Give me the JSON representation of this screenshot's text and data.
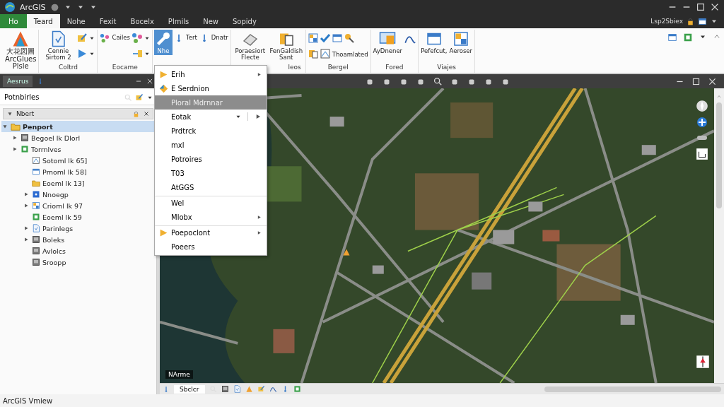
{
  "window": {
    "title": "ArcGIS",
    "user": "Lsp2Sbiex"
  },
  "tabs": [
    {
      "label": "Ho",
      "kind": "file",
      "selected": false
    },
    {
      "label": "Teard",
      "kind": "tab",
      "selected": true
    },
    {
      "label": "Nohe",
      "kind": "tab",
      "selected": false
    },
    {
      "label": "Fexit",
      "kind": "tab",
      "selected": false
    },
    {
      "label": "Bocelx",
      "kind": "tab",
      "selected": false
    },
    {
      "label": "Plmils",
      "kind": "tab",
      "selected": false
    },
    {
      "label": "New",
      "kind": "tab",
      "selected": false
    },
    {
      "label": "Sopidy",
      "kind": "tab",
      "selected": false
    }
  ],
  "ribbon": {
    "groups": [
      {
        "buttons": [
          {
            "label": "大花図圖 ArcGlues Plsle",
            "kind": "large",
            "selected": false
          }
        ]
      },
      {
        "label": "Coltrd",
        "buttons": [
          {
            "label": "Cennie Sirtom 2",
            "kind": "large",
            "selected": false
          },
          {
            "kind": "stack",
            "selected": false
          }
        ]
      },
      {
        "label": "Eocame",
        "buttons": [
          {
            "label": "Cailes",
            "kind": "small",
            "selected": false
          },
          {
            "kind": "stack",
            "selected": false
          }
        ]
      },
      {
        "buttons": [
          {
            "label": "Nhe",
            "kind": "large",
            "selected": true
          },
          {
            "label": "Tert",
            "kind": "small",
            "selected": false
          },
          {
            "label": "Dnatr",
            "kind": "small",
            "selected": false
          }
        ]
      },
      {
        "label": "leos",
        "buttons": [
          {
            "label": "Poraesiort Flecte",
            "kind": "large",
            "selected": false
          },
          {
            "label": "FenGaldish Sant",
            "kind": "large",
            "selected": false
          }
        ]
      },
      {
        "label": "Bergel",
        "buttons": [
          {
            "label": "Thoamlated",
            "kind": "small",
            "selected": false
          }
        ]
      },
      {
        "label": "Fored",
        "buttons": [
          {
            "label": "AyDnener",
            "kind": "large",
            "selected": false
          }
        ]
      },
      {
        "label": "Viajes",
        "buttons": [
          {
            "label": "Pefefcut,",
            "kind": "large",
            "selected": false
          },
          {
            "label": "Aeroser",
            "kind": "large",
            "selected": false
          }
        ]
      }
    ]
  },
  "contents_pane": {
    "tab": "Aesrus",
    "search": {
      "value": "Potnbirles"
    },
    "header": "Nbert",
    "tree": [
      {
        "label": "Penport",
        "selected": true,
        "expanded": true,
        "children": [
          {
            "label": "Begoel lk Dlorl",
            "selected": false,
            "expanded": false
          },
          {
            "label": "Torrnlves",
            "selected": false,
            "expanded": false
          },
          {
            "label": "Sotoml lk 65]",
            "selected": false
          },
          {
            "label": "Pmoml lk 58]",
            "selected": false
          },
          {
            "label": "Eoeml lk 13]",
            "selected": false
          },
          {
            "label": "Nnoegp",
            "selected": false,
            "expanded": false
          },
          {
            "label": "Crioml lk 97",
            "selected": false,
            "expanded": false
          },
          {
            "label": "Eoeml lk 59",
            "selected": false
          },
          {
            "label": "Parinlegs",
            "selected": false,
            "expanded": false
          },
          {
            "label": "Boleks",
            "selected": false,
            "expanded": false
          },
          {
            "label": "Avlolcs",
            "selected": false
          },
          {
            "label": "Sroopp",
            "selected": false
          }
        ]
      }
    ]
  },
  "context_menu": {
    "items": [
      {
        "label": "Erih",
        "kind": "icon",
        "submenu": true,
        "selected": false,
        "separator_before": false
      },
      {
        "label": "E Serdnion",
        "kind": "icon",
        "submenu": false,
        "selected": false,
        "separator_before": false
      },
      {
        "label": "Ploral Mdrnnar",
        "kind": "plain",
        "submenu": false,
        "selected": true,
        "separator_before": false
      },
      {
        "label": "Eotak",
        "kind": "split",
        "submenu": false,
        "selected": false,
        "separator_before": false
      },
      {
        "label": "Prdtrck",
        "kind": "plain",
        "submenu": false,
        "selected": false,
        "separator_before": false
      },
      {
        "label": "mxl",
        "kind": "plain",
        "submenu": false,
        "selected": false,
        "separator_before": false
      },
      {
        "label": "Potroires",
        "kind": "plain",
        "submenu": false,
        "selected": false,
        "separator_before": false
      },
      {
        "label": "T03",
        "kind": "plain",
        "submenu": false,
        "selected": false,
        "separator_before": false
      },
      {
        "label": "AtGGS",
        "kind": "plain",
        "submenu": false,
        "selected": false,
        "separator_before": false
      },
      {
        "label": "Wel",
        "kind": "plain",
        "submenu": false,
        "selected": false,
        "separator_before": true
      },
      {
        "label": "Mlobx",
        "kind": "plain",
        "submenu": true,
        "selected": false,
        "separator_before": false
      },
      {
        "label": "Poepoclont",
        "kind": "icon",
        "submenu": true,
        "selected": false,
        "separator_before": true
      },
      {
        "label": "Poeers",
        "kind": "plain",
        "submenu": false,
        "selected": false,
        "separator_before": false
      }
    ]
  },
  "map_view": {
    "scale_label": "NArme",
    "bottom_tab": "Sbclcr"
  },
  "status_bar": {
    "text": "ArcGIS Vmiew"
  }
}
